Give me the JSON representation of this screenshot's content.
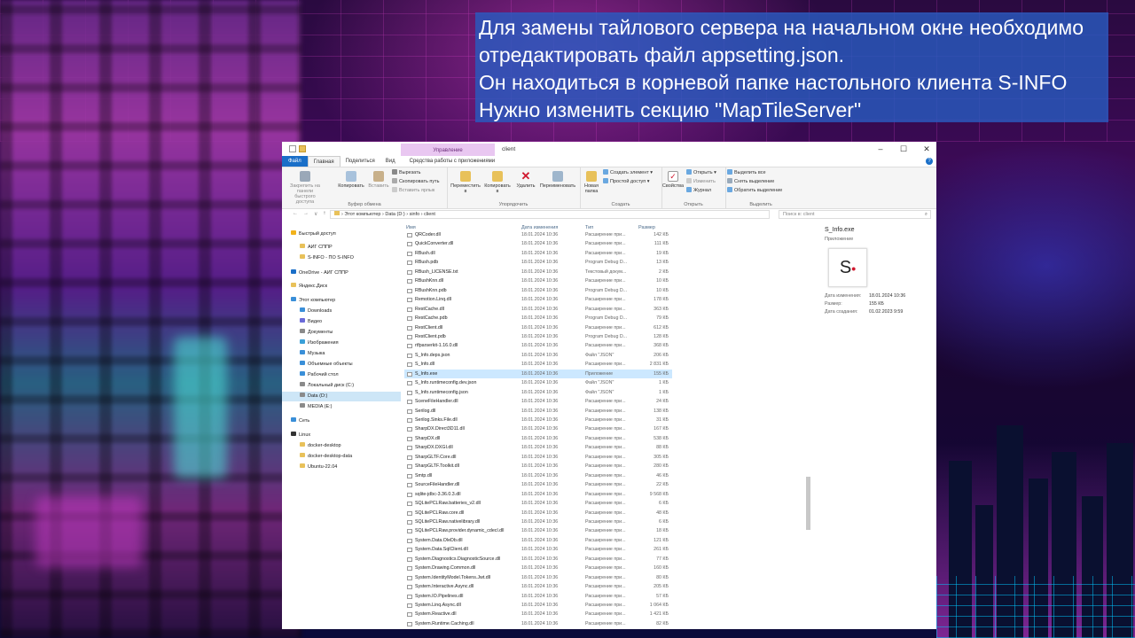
{
  "caption": {
    "lines": [
      "Для замены тайлового сервера на начальном окне необходимо",
      "отредактировать файл appsetting.json.",
      "Он находиться в корневой папке настольного клиента S-INFO",
      "Нужно изменить секцию \"MapTileServer\""
    ]
  },
  "window": {
    "context_tab": "Управление",
    "title": "client",
    "controls": [
      "–",
      "☐",
      "✕"
    ]
  },
  "ribbon_tabs": [
    "Файл",
    "Главная",
    "Поделиться",
    "Вид",
    "Средства работы с приложениями"
  ],
  "ribbon": {
    "clipboard": {
      "label": "Буфер обмена",
      "pin": "Закрепить на панели быстрого доступа",
      "copy": "Копировать",
      "paste": "Вставить",
      "cut": "Вырезать",
      "copy_path": "Скопировать путь",
      "paste_shortcut": "Вставить ярлык"
    },
    "organize": {
      "label": "Упорядочить",
      "move": "Переместить в",
      "copy_to": "Копировать в",
      "delete": "Удалить",
      "rename": "Переименовать"
    },
    "create": {
      "label": "Создать",
      "new_folder": "Новая папка",
      "new_item": "Создать элемент",
      "easy_access": "Простой доступ"
    },
    "open": {
      "label": "Открыть",
      "properties": "Свойства",
      "open": "Открыть",
      "edit": "Изменить",
      "history": "Журнал"
    },
    "select": {
      "label": "Выделить",
      "select_all": "Выделить все",
      "select_none": "Снять выделение",
      "invert": "Обратить выделение"
    }
  },
  "address": {
    "nav": [
      "←",
      "→",
      "∨",
      "↑"
    ],
    "path": "›  Этот компьютер  ›  Data (D:)  ›  sinfo  ›  client",
    "search_placeholder": "Поиск в: client"
  },
  "nav_pane": [
    {
      "label": "Быстрый доступ",
      "icon": "star-icon",
      "color": "#f2b21b",
      "indent": 0
    },
    {
      "label": "АИГ СППР",
      "icon": "folder-icon",
      "color": "#e8c15a",
      "indent": 1
    },
    {
      "label": "S-INFO - ПО S-INFO",
      "icon": "folder-icon",
      "color": "#e8c15a",
      "indent": 1
    },
    {
      "label": "OneDrive - АИГ СППР",
      "icon": "cloud-icon",
      "color": "#1a6fc8",
      "indent": 0
    },
    {
      "label": "Яндекс.Диск",
      "icon": "disk-icon",
      "color": "#e8c15a",
      "indent": 0
    },
    {
      "label": "Этот компьютер",
      "icon": "computer-icon",
      "color": "#3a8fd8",
      "indent": 0
    },
    {
      "label": "Downloads",
      "icon": "download-icon",
      "color": "#3a8fd8",
      "indent": 1
    },
    {
      "label": "Видео",
      "icon": "video-icon",
      "color": "#6a6ad8",
      "indent": 1
    },
    {
      "label": "Документы",
      "icon": "document-icon",
      "color": "#8a8a8a",
      "indent": 1
    },
    {
      "label": "Изображения",
      "icon": "image-icon",
      "color": "#3aa0d8",
      "indent": 1
    },
    {
      "label": "Музыка",
      "icon": "music-icon",
      "color": "#3a8fd8",
      "indent": 1
    },
    {
      "label": "Объемные объекты",
      "icon": "cube-icon",
      "color": "#3a8fd8",
      "indent": 1
    },
    {
      "label": "Рабочий стол",
      "icon": "desktop-icon",
      "color": "#3a8fd8",
      "indent": 1
    },
    {
      "label": "Локальный диск (C:)",
      "icon": "drive-icon",
      "color": "#8a8a8a",
      "indent": 1
    },
    {
      "label": "Data (D:)",
      "icon": "drive-icon",
      "color": "#8a8a8a",
      "indent": 1,
      "selected": true
    },
    {
      "label": "MEDIA (E:)",
      "icon": "drive-icon",
      "color": "#8a8a8a",
      "indent": 1
    },
    {
      "label": "Сеть",
      "icon": "network-icon",
      "color": "#3a8fd8",
      "indent": 0
    },
    {
      "label": "Linux",
      "icon": "linux-icon",
      "color": "#333333",
      "indent": 0
    },
    {
      "label": "docker-desktop",
      "icon": "folder-icon",
      "color": "#e8c15a",
      "indent": 1
    },
    {
      "label": "docker-desktop-data",
      "icon": "folder-icon",
      "color": "#e8c15a",
      "indent": 1
    },
    {
      "label": "Ubuntu-22.04",
      "icon": "folder-icon",
      "color": "#e8c15a",
      "indent": 1
    }
  ],
  "columns": {
    "name": "Имя",
    "date": "Дата изменения",
    "type": "Тип",
    "size": "Размер"
  },
  "files": [
    {
      "name": "QRCoder.dll",
      "date": "18.01.2024 10:36",
      "type": "Расширение при...",
      "size": "142 КБ"
    },
    {
      "name": "QuickConverter.dll",
      "date": "18.01.2024 10:36",
      "type": "Расширение при...",
      "size": "111 КБ"
    },
    {
      "name": "RBush.dll",
      "date": "18.01.2024 10:36",
      "type": "Расширение при...",
      "size": "19 КБ"
    },
    {
      "name": "RBush.pdb",
      "date": "18.01.2024 10:36",
      "type": "Program Debug D...",
      "size": "13 КБ"
    },
    {
      "name": "RBush_LICENSE.txt",
      "date": "18.01.2024 10:36",
      "type": "Текстовый докум...",
      "size": "2 КБ"
    },
    {
      "name": "RBushKnn.dll",
      "date": "18.01.2024 10:36",
      "type": "Расширение при...",
      "size": "10 КБ"
    },
    {
      "name": "RBushKnn.pdb",
      "date": "18.01.2024 10:36",
      "type": "Program Debug D...",
      "size": "10 КБ"
    },
    {
      "name": "Remotion.Linq.dll",
      "date": "18.01.2024 10:36",
      "type": "Расширение при...",
      "size": "178 КБ"
    },
    {
      "name": "RestCache.dll",
      "date": "18.01.2024 10:36",
      "type": "Расширение при...",
      "size": "363 КБ"
    },
    {
      "name": "RestCache.pdb",
      "date": "18.01.2024 10:36",
      "type": "Program Debug D...",
      "size": "79 КБ"
    },
    {
      "name": "RestClient.dll",
      "date": "18.01.2024 10:36",
      "type": "Расширение при...",
      "size": "612 КБ"
    },
    {
      "name": "RestClient.pdb",
      "date": "18.01.2024 10:36",
      "type": "Program Debug D...",
      "size": "128 КБ"
    },
    {
      "name": "rtfparserkit-1.16.0.dll",
      "date": "18.01.2024 10:36",
      "type": "Расширение при...",
      "size": "368 КБ"
    },
    {
      "name": "S_Info.deps.json",
      "date": "18.01.2024 10:36",
      "type": "Файл \"JSON\"",
      "size": "206 КБ"
    },
    {
      "name": "S_Info.dll",
      "date": "18.01.2024 10:36",
      "type": "Расширение при...",
      "size": "2 831 КБ"
    },
    {
      "name": "S_Info.exe",
      "date": "18.01.2024 10:36",
      "type": "Приложение",
      "size": "155 КБ",
      "selected": true
    },
    {
      "name": "S_Info.runtimeconfig.dev.json",
      "date": "18.01.2024 10:36",
      "type": "Файл \"JSON\"",
      "size": "1 КБ"
    },
    {
      "name": "S_Info.runtimeconfig.json",
      "date": "18.01.2024 10:36",
      "type": "Файл \"JSON\"",
      "size": "1 КБ"
    },
    {
      "name": "SceneFileHandler.dll",
      "date": "18.01.2024 10:36",
      "type": "Расширение при...",
      "size": "24 КБ"
    },
    {
      "name": "Serilog.dll",
      "date": "18.01.2024 10:36",
      "type": "Расширение при...",
      "size": "138 КБ"
    },
    {
      "name": "Serilog.Sinks.File.dll",
      "date": "18.01.2024 10:36",
      "type": "Расширение при...",
      "size": "31 КБ"
    },
    {
      "name": "SharpDX.Direct3D11.dll",
      "date": "18.01.2024 10:36",
      "type": "Расширение при...",
      "size": "167 КБ"
    },
    {
      "name": "SharpDX.dll",
      "date": "18.01.2024 10:36",
      "type": "Расширение при...",
      "size": "538 КБ"
    },
    {
      "name": "SharpDX.DXGI.dll",
      "date": "18.01.2024 10:36",
      "type": "Расширение при...",
      "size": "88 КБ"
    },
    {
      "name": "SharpGLTF.Core.dll",
      "date": "18.01.2024 10:36",
      "type": "Расширение при...",
      "size": "305 КБ"
    },
    {
      "name": "SharpGLTF.Toolkit.dll",
      "date": "18.01.2024 10:36",
      "type": "Расширение при...",
      "size": "280 КБ"
    },
    {
      "name": "Smtp.dll",
      "date": "18.01.2024 10:36",
      "type": "Расширение при...",
      "size": "46 КБ"
    },
    {
      "name": "SourceFileHandler.dll",
      "date": "18.01.2024 10:36",
      "type": "Расширение при...",
      "size": "22 КБ"
    },
    {
      "name": "sqlite-jdbc-3.36.0.3.dll",
      "date": "18.01.2024 10:36",
      "type": "Расширение при...",
      "size": "9 568 КБ"
    },
    {
      "name": "SQLitePCLRaw.batteries_v2.dll",
      "date": "18.01.2024 10:36",
      "type": "Расширение при...",
      "size": "6 КБ"
    },
    {
      "name": "SQLitePCLRaw.core.dll",
      "date": "18.01.2024 10:36",
      "type": "Расширение при...",
      "size": "48 КБ"
    },
    {
      "name": "SQLitePCLRaw.nativelibrary.dll",
      "date": "18.01.2024 10:36",
      "type": "Расширение при...",
      "size": "6 КБ"
    },
    {
      "name": "SQLitePCLRaw.provider.dynamic_cdecl.dll",
      "date": "18.01.2024 10:36",
      "type": "Расширение при...",
      "size": "18 КБ"
    },
    {
      "name": "System.Data.OleDb.dll",
      "date": "18.01.2024 10:36",
      "type": "Расширение при...",
      "size": "121 КБ"
    },
    {
      "name": "System.Data.SqlClient.dll",
      "date": "18.01.2024 10:36",
      "type": "Расширение при...",
      "size": "261 КБ"
    },
    {
      "name": "System.Diagnostics.DiagnosticSource.dll",
      "date": "18.01.2024 10:36",
      "type": "Расширение при...",
      "size": "77 КБ"
    },
    {
      "name": "System.Drawing.Common.dll",
      "date": "18.01.2024 10:36",
      "type": "Расширение при...",
      "size": "160 КБ"
    },
    {
      "name": "System.IdentityModel.Tokens.Jwt.dll",
      "date": "18.01.2024 10:36",
      "type": "Расширение при...",
      "size": "80 КБ"
    },
    {
      "name": "System.Interactive.Async.dll",
      "date": "18.01.2024 10:36",
      "type": "Расширение при...",
      "size": "205 КБ"
    },
    {
      "name": "System.IO.Pipelines.dll",
      "date": "18.01.2024 10:36",
      "type": "Расширение при...",
      "size": "57 КБ"
    },
    {
      "name": "System.Linq.Async.dll",
      "date": "18.01.2024 10:36",
      "type": "Расширение при...",
      "size": "1 064 КБ"
    },
    {
      "name": "System.Reactive.dll",
      "date": "18.01.2024 10:36",
      "type": "Расширение при...",
      "size": "1 421 КБ"
    },
    {
      "name": "System.Runtime.Caching.dll",
      "date": "18.01.2024 10:36",
      "type": "Расширение при...",
      "size": "82 КБ"
    }
  ],
  "preview": {
    "name": "S_Info.exe",
    "type": "Приложение",
    "icon_text": "S",
    "meta": [
      {
        "label": "Дата изменения:",
        "value": "18.01.2024 10:36"
      },
      {
        "label": "Размер:",
        "value": "155 КБ"
      },
      {
        "label": "Дата создания:",
        "value": "01.02.2023 9:59"
      }
    ]
  }
}
